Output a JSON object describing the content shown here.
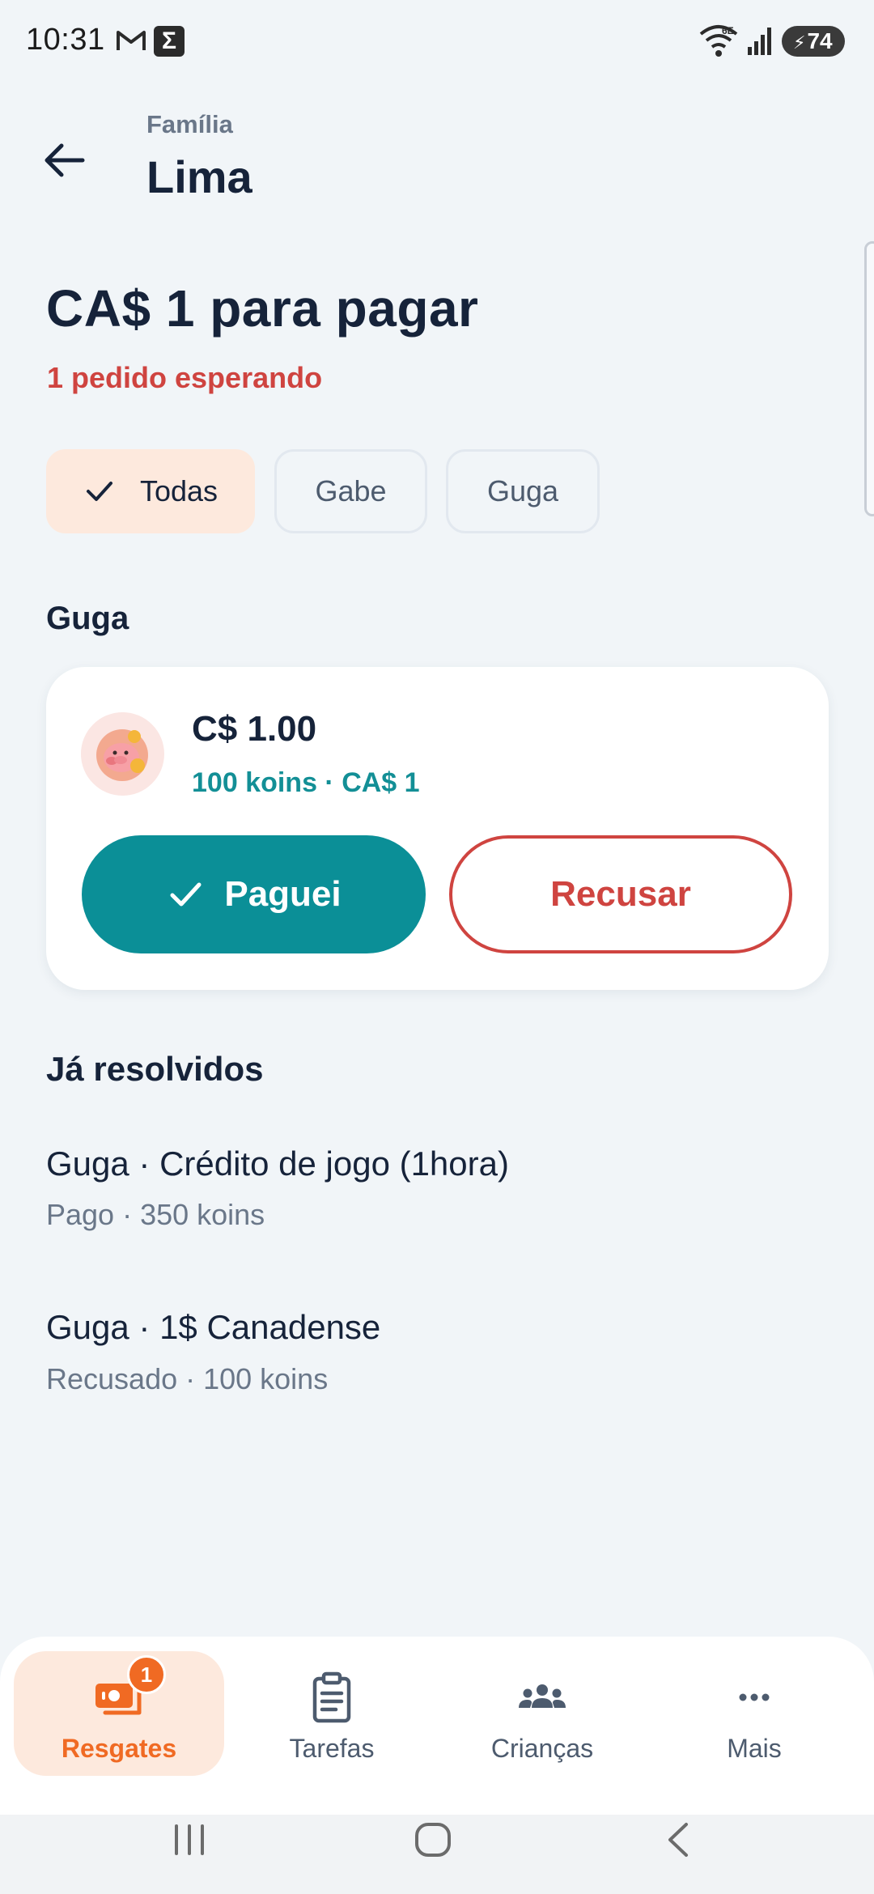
{
  "status_bar": {
    "time": "10:31",
    "battery": "74",
    "wifi_label": "6E"
  },
  "header": {
    "family_label": "Família",
    "family_name": "Lima"
  },
  "summary": {
    "amount_title": "CA$  1 para pagar",
    "pending_text": "1 pedido esperando"
  },
  "filters": [
    {
      "label": "Todas",
      "selected": true
    },
    {
      "label": "Gabe",
      "selected": false
    },
    {
      "label": "Guga",
      "selected": false
    }
  ],
  "pending_section": {
    "child_name": "Guga",
    "request": {
      "title": "C$ 1.00",
      "subtitle": "100 koins · CA$  1",
      "paid_button": "Paguei",
      "refuse_button": "Recusar"
    }
  },
  "resolved_section": {
    "heading": "Já resolvidos",
    "items": [
      {
        "title": "Guga · Crédito de jogo (1hora)",
        "subtitle": "Pago · 350 koins"
      },
      {
        "title": "Guga · 1$ Canadense",
        "subtitle": "Recusado · 100 koins"
      }
    ]
  },
  "bottom_nav": {
    "items": [
      {
        "label": "Resgates",
        "icon": "money-icon",
        "active": true,
        "badge": "1"
      },
      {
        "label": "Tarefas",
        "icon": "clipboard-icon",
        "active": false
      },
      {
        "label": "Crianças",
        "icon": "people-icon",
        "active": false
      },
      {
        "label": "Mais",
        "icon": "more-icon",
        "active": false
      }
    ]
  },
  "colors": {
    "accent_teal": "#0b8f97",
    "danger_red": "#cf4440",
    "nav_active_orange": "#f06a23",
    "chip_active_bg": "#fde9dd",
    "background": "#f1f5f8"
  }
}
